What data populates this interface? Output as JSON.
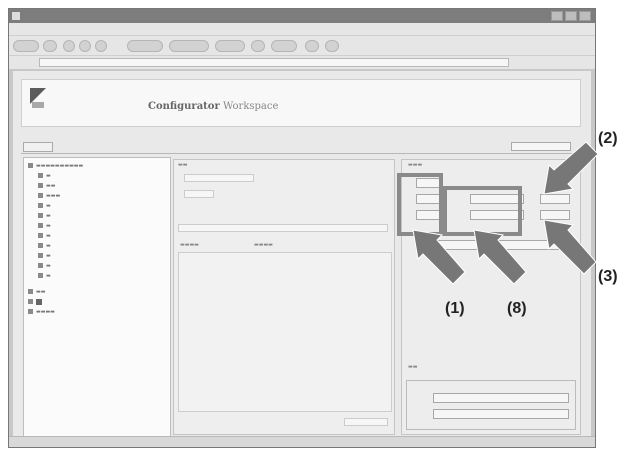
{
  "window": {
    "title": "",
    "menu": [
      "",
      "",
      "",
      "",
      "",
      ""
    ]
  },
  "address": {
    "value": ""
  },
  "banner": {
    "brand_bold": "Configurator",
    "brand_rest": "Workspace"
  },
  "tab": {
    "label": ""
  },
  "filter": {
    "label": ""
  },
  "tree": {
    "selected_label": ""
  },
  "status": {
    "left": "",
    "right": ""
  },
  "callouts": {
    "one": "(1)",
    "two": "(2)",
    "three": "(3)",
    "eight": "(8)"
  },
  "colors": {
    "highlight": "#8a8a8a",
    "arrow": "#777777"
  }
}
